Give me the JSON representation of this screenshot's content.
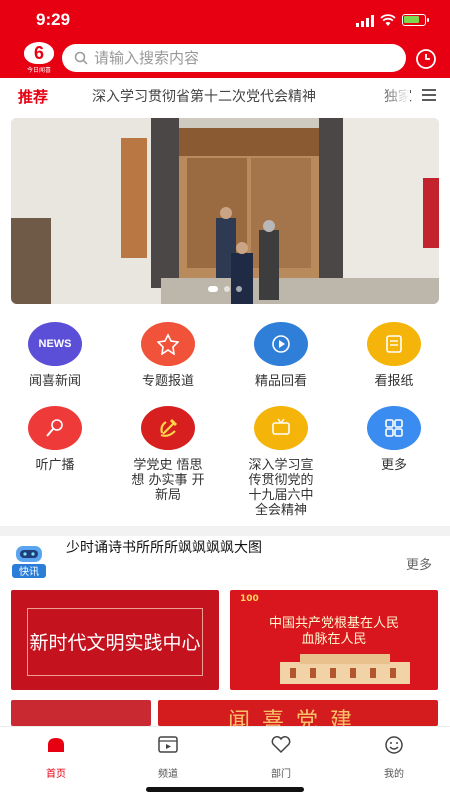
{
  "status": {
    "time": "9:29"
  },
  "header": {
    "logo_label": "今日闻喜",
    "search_placeholder": "请输入搜索内容",
    "brand_color": "#e60012"
  },
  "tabs": [
    {
      "label": "推荐",
      "active": true
    },
    {
      "label": "深入学习贯彻省第十二次党代会精神",
      "active": false
    },
    {
      "label": "独家",
      "active": false
    }
  ],
  "banner": {
    "slides": 3,
    "active_slide": 1
  },
  "grid": [
    {
      "label": "闻喜新闻",
      "icon": "news-icon",
      "color": "#5b4fd8",
      "badge": "NEWS"
    },
    {
      "label": "专题报道",
      "icon": "star-badge-icon",
      "color": "#f0523a"
    },
    {
      "label": "精品回看",
      "icon": "replay-icon",
      "color": "#2f7fd8"
    },
    {
      "label": "看报纸",
      "icon": "newspaper-icon",
      "color": "#f5b40a"
    },
    {
      "label": "听广播",
      "icon": "microphone-icon",
      "color": "#ef3a3a"
    },
    {
      "label": "学党史 悟思想 办实事 开新局",
      "icon": "party-emblem-icon",
      "color": "#d71f1f"
    },
    {
      "label": "深入学习宣传贯彻党的十九届六中全会精神",
      "icon": "tv-icon",
      "color": "#f5b40a"
    },
    {
      "label": "更多",
      "icon": "grid-more-icon",
      "color": "#3b8cf0"
    }
  ],
  "quick_news": {
    "badge": "快讯",
    "text": "少时诵诗书所所所飒飒飒飒大图 ",
    "more_label": "更多"
  },
  "news_cards": {
    "card1_title": "新时代文明实践中心",
    "card2_line1": "中国共产党根基在人民",
    "card2_line2": "血脉在人民",
    "card2_logo": "100",
    "card4_title": "闻喜党建"
  },
  "bottom_nav": [
    {
      "label": "首页",
      "icon": "home-icon",
      "active": true
    },
    {
      "label": "频道",
      "icon": "channel-icon",
      "active": false
    },
    {
      "label": "部门",
      "icon": "heart-icon",
      "active": false
    },
    {
      "label": "我的",
      "icon": "smiley-icon",
      "active": false
    }
  ]
}
